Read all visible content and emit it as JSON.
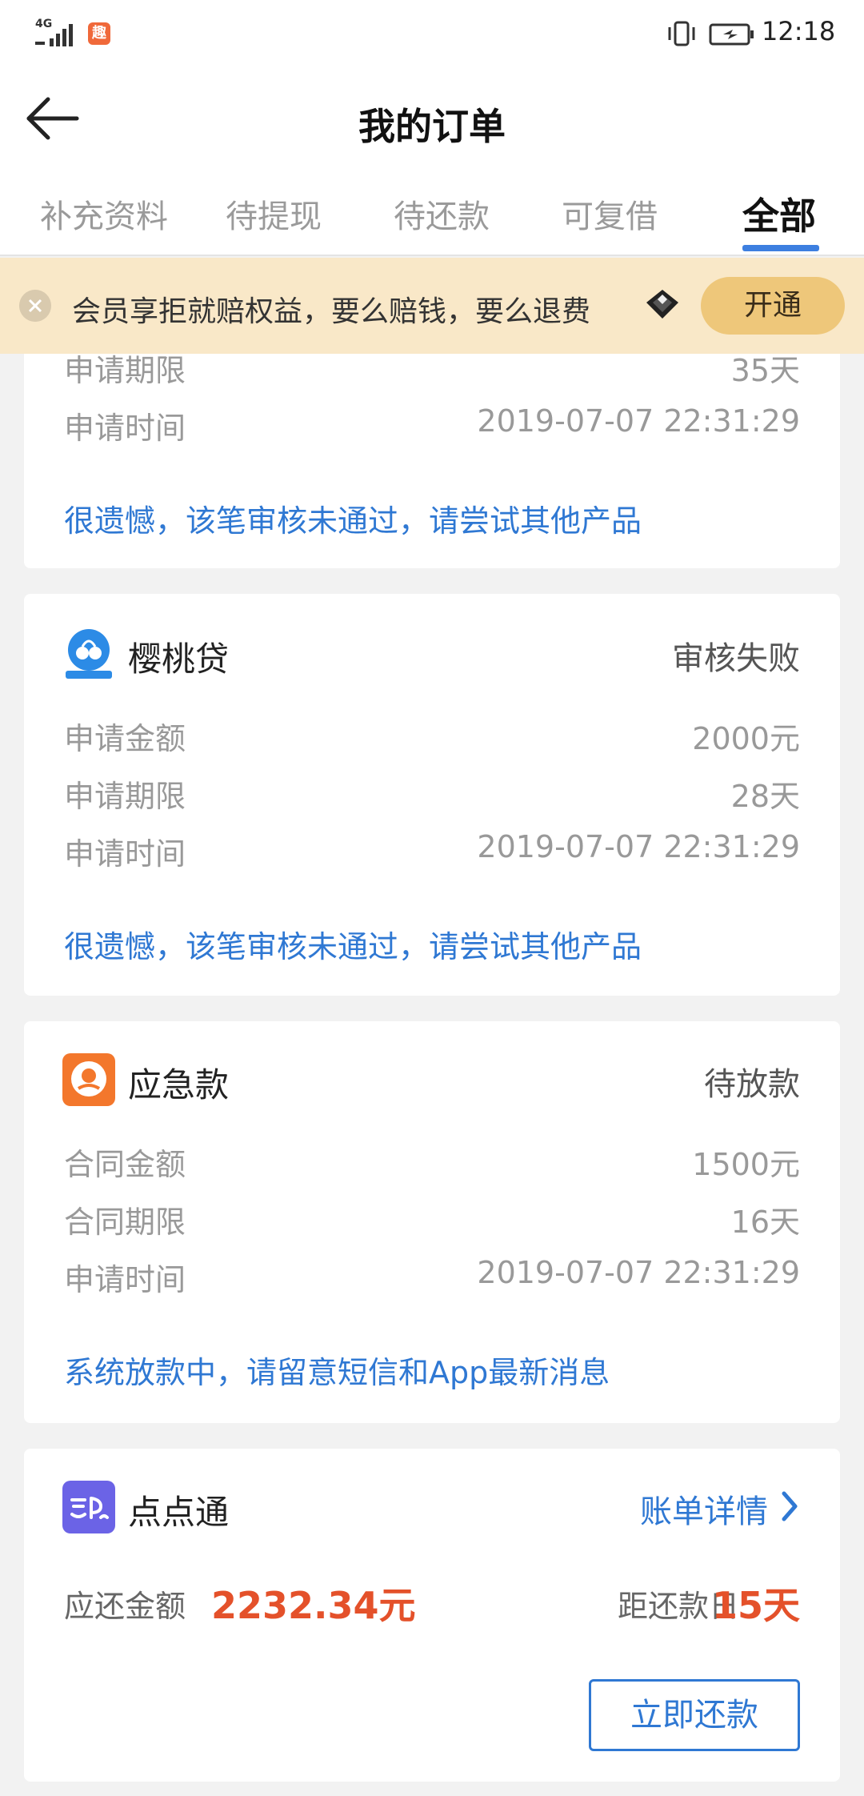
{
  "status_bar": {
    "network": "4G",
    "time": "12:18",
    "app_badge": "趣"
  },
  "header": {
    "title": "我的订单"
  },
  "tabs": [
    {
      "label": "补充资料"
    },
    {
      "label": "待提现"
    },
    {
      "label": "待还款"
    },
    {
      "label": "可复借"
    },
    {
      "label": "全部",
      "active": true
    }
  ],
  "banner": {
    "text": "会员享拒就赔权益，要么赔钱，要么退费",
    "button": "开通"
  },
  "cards": [
    {
      "rows": [
        {
          "label": "申请期限",
          "value": "35天"
        },
        {
          "label": "申请时间",
          "value": "2019-07-07 22:31:29"
        }
      ],
      "note": "很遗憾，该笔审核未通过，请尝试其他产品"
    },
    {
      "name": "樱桃贷",
      "logo_icon": "cherry-icon",
      "status": "审核失败",
      "rows": [
        {
          "label": "申请金额",
          "value": "2000元"
        },
        {
          "label": "申请期限",
          "value": "28天"
        },
        {
          "label": "申请时间",
          "value": "2019-07-07 22:31:29"
        }
      ],
      "note": "很遗憾，该笔审核未通过，请尝试其他产品"
    },
    {
      "name": "应急款",
      "logo_icon": "emergency-loan-icon",
      "status": "待放款",
      "rows": [
        {
          "label": "合同金额",
          "value": "1500元"
        },
        {
          "label": "合同期限",
          "value": "16天"
        },
        {
          "label": "申请时间",
          "value": "2019-07-07 22:31:29"
        }
      ],
      "note": "系统放款中，请留意短信和App最新消息"
    },
    {
      "name": "点点通",
      "logo_icon": "diandiantong-icon",
      "link": "账单详情",
      "due_label": "应还金额",
      "due_amount": "2232.34元",
      "days_label": "距还款日",
      "days_value": "15天",
      "button": "立即还款"
    }
  ],
  "colors": {
    "accent_blue": "#2f78d3",
    "tab_underline": "#3d7fe0",
    "highlight_red": "#e4512a",
    "banner_bg": "#f9e8c8",
    "banner_button": "#eec77a"
  }
}
